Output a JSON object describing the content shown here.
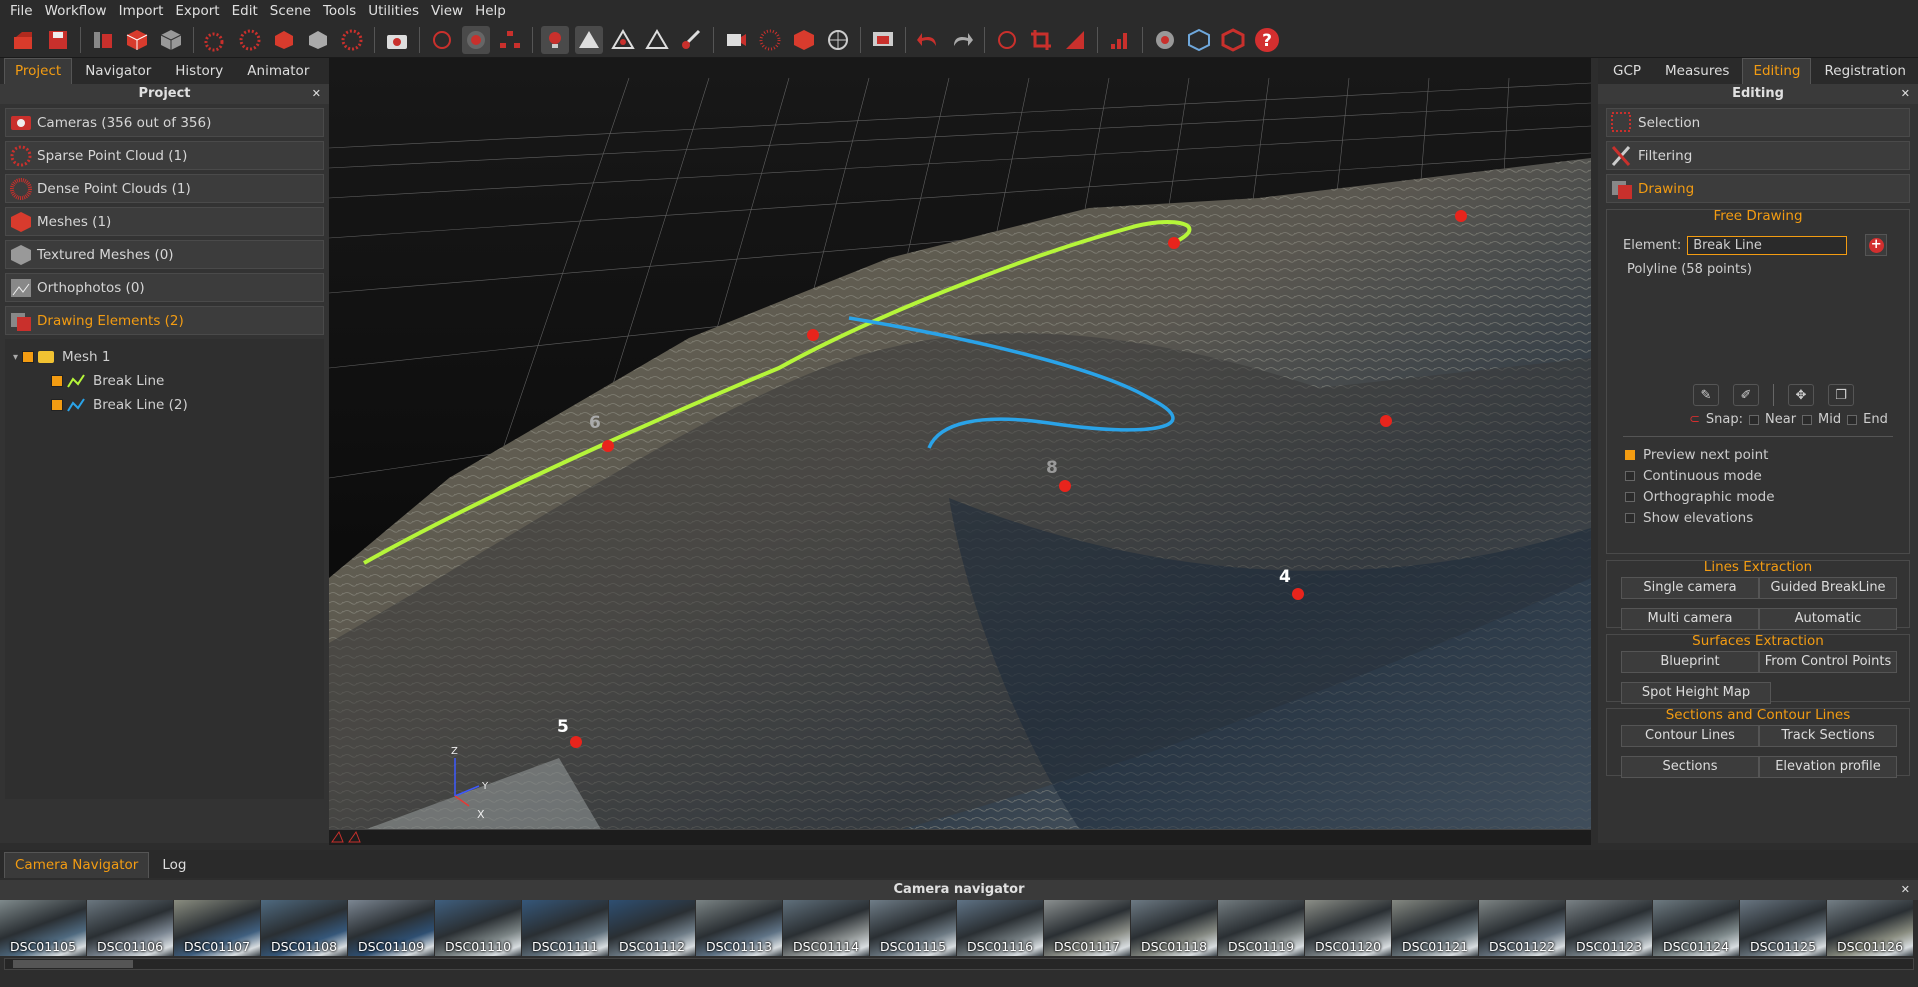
{
  "menu": [
    "File",
    "Workflow",
    "Import",
    "Export",
    "Edit",
    "Scene",
    "Tools",
    "Utilities",
    "View",
    "Help"
  ],
  "left": {
    "tabs": [
      "Project",
      "Navigator",
      "History",
      "Animator"
    ],
    "title": "Project",
    "items": [
      "Cameras (356 out of 356)",
      "Sparse Point Cloud (1)",
      "Dense Point Clouds (1)",
      "Meshes (1)",
      "Textured Meshes (0)",
      "Orthophotos (0)",
      "Drawing Elements (2)"
    ],
    "tree": {
      "mesh": "Mesh 1",
      "lines": [
        "Break Line",
        "Break Line (2)"
      ]
    }
  },
  "viewport": {
    "labels": [
      "6",
      "8",
      "4",
      "5"
    ],
    "axes": {
      "z": "Z",
      "y": "Y",
      "x": "X"
    }
  },
  "right": {
    "tabs": [
      "GCP",
      "Measures",
      "Editing",
      "Registration"
    ],
    "title": "Editing",
    "tools": [
      "Selection",
      "Filtering",
      "Drawing"
    ],
    "free": {
      "title": "Free Drawing",
      "element_label": "Element:",
      "element_value": "Break Line",
      "polyline": "Polyline (58 points)",
      "snap": "Snap:",
      "snap_opts": [
        "Near",
        "Mid",
        "End"
      ],
      "opts": [
        "Preview next point",
        "Continuous mode",
        "Orthographic mode",
        "Show elevations"
      ]
    },
    "lines": {
      "title": "Lines Extraction",
      "btns": [
        "Single camera",
        "Guided BreakLine",
        "Multi camera",
        "Automatic"
      ]
    },
    "surfaces": {
      "title": "Surfaces Extraction",
      "btns": [
        "Blueprint",
        "From Control Points",
        "Spot Height Map"
      ]
    },
    "sections": {
      "title": "Sections and Contour Lines",
      "btns": [
        "Contour Lines",
        "Track Sections",
        "Sections",
        "Elevation profile"
      ]
    }
  },
  "bottom": {
    "tabs": [
      "Camera Navigator",
      "Log"
    ],
    "title": "Camera navigator",
    "thumbs": [
      "DSC01105",
      "DSC01106",
      "DSC01107",
      "DSC01108",
      "DSC01109",
      "DSC01110",
      "DSC01111",
      "DSC01112",
      "DSC01113",
      "DSC01114",
      "DSC01115",
      "DSC01116",
      "DSC01117",
      "DSC01118",
      "DSC01119",
      "DSC01120",
      "DSC01121",
      "DSC01122",
      "DSC01123",
      "DSC01124",
      "DSC01125",
      "DSC01126"
    ]
  },
  "colors": {
    "accent": "#f39c12",
    "green_line": "#b5f53a",
    "blue_line": "#2aa3e8",
    "marker": "#e8241c"
  }
}
